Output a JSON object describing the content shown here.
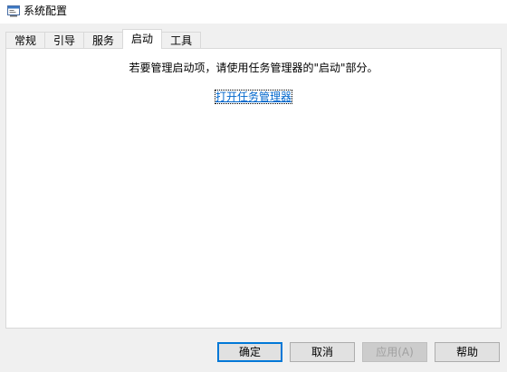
{
  "window": {
    "title": "系统配置",
    "icon": "msconfig-icon"
  },
  "tabs": [
    {
      "label": "常规",
      "active": false
    },
    {
      "label": "引导",
      "active": false
    },
    {
      "label": "服务",
      "active": false
    },
    {
      "label": "启动",
      "active": true
    },
    {
      "label": "工具",
      "active": false
    }
  ],
  "startup": {
    "message": "若要管理启动项，请使用任务管理器的\"启动\"部分。",
    "link_label": "打开任务管理器"
  },
  "buttons": {
    "ok": "确定",
    "cancel": "取消",
    "apply": "应用(A)",
    "help": "帮助"
  },
  "colors": {
    "link": "#0066cc",
    "default_button_border": "#0078d7"
  }
}
